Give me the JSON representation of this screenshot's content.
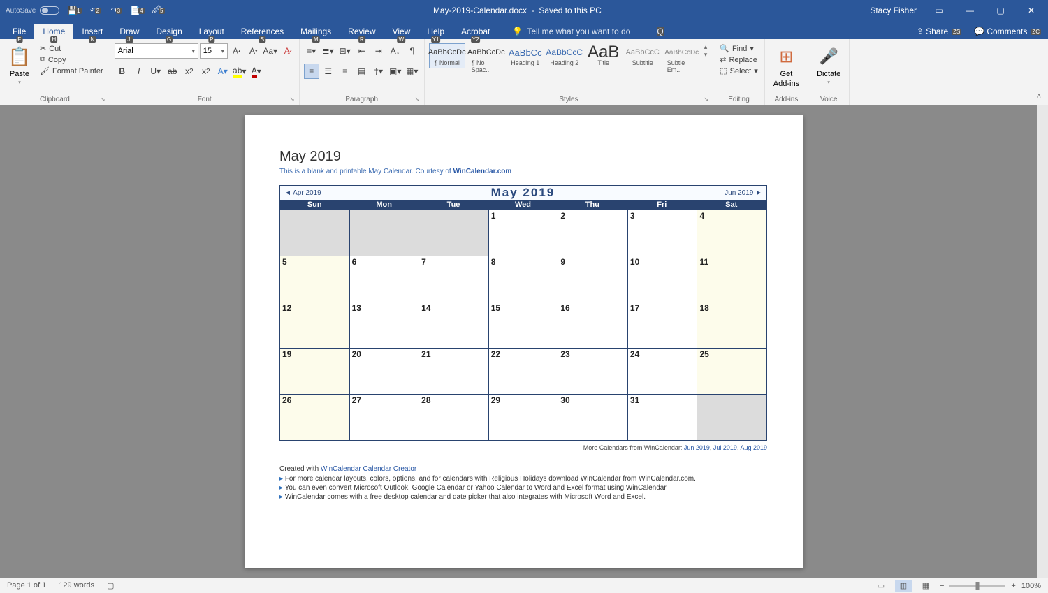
{
  "title_bar": {
    "autosave": "AutoSave",
    "filename": "May-2019-Calendar.docx",
    "savestate": "Saved to this PC",
    "user": "Stacy Fisher",
    "qat_badges": [
      "1",
      "2",
      "3",
      "4",
      "5"
    ]
  },
  "tabs": {
    "items": [
      {
        "label": "File",
        "k": "F"
      },
      {
        "label": "Home",
        "k": "H"
      },
      {
        "label": "Insert",
        "k": "N"
      },
      {
        "label": "Draw",
        "k": "JI"
      },
      {
        "label": "Design",
        "k": "G"
      },
      {
        "label": "Layout",
        "k": "P"
      },
      {
        "label": "References",
        "k": "S"
      },
      {
        "label": "Mailings",
        "k": "M"
      },
      {
        "label": "Review",
        "k": "R"
      },
      {
        "label": "View",
        "k": "W"
      },
      {
        "label": "Help",
        "k": "Y1"
      },
      {
        "label": "Acrobat",
        "k": "Y2"
      }
    ],
    "tellme_placeholder": "Tell me what you want to do",
    "tellme_k": "Q",
    "share": "Share",
    "share_k": "ZS",
    "comments": "Comments",
    "comments_k": "ZC"
  },
  "ribbon": {
    "clipboard": {
      "paste": "Paste",
      "cut": "Cut",
      "copy": "Copy",
      "format_painter": "Format Painter",
      "label": "Clipboard"
    },
    "font": {
      "name": "Arial",
      "size": "15",
      "label": "Font"
    },
    "paragraph": {
      "label": "Paragraph"
    },
    "styles": {
      "items": [
        {
          "p": "AaBbCcDc",
          "n": "¶ Normal"
        },
        {
          "p": "AaBbCcDc",
          "n": "¶ No Spac..."
        },
        {
          "p": "AaBbCc",
          "n": "Heading 1"
        },
        {
          "p": "AaBbCcC",
          "n": "Heading 2"
        },
        {
          "p": "AaB",
          "n": "Title"
        },
        {
          "p": "AaBbCcC",
          "n": "Subtitle"
        },
        {
          "p": "AaBbCcDc",
          "n": "Subtle Em..."
        }
      ],
      "label": "Styles"
    },
    "editing": {
      "find": "Find",
      "replace": "Replace",
      "select": "Select",
      "label": "Editing"
    },
    "addins": {
      "get": "Get",
      "addins": "Add-ins",
      "label": "Add-ins"
    },
    "voice": {
      "dictate": "Dictate",
      "label": "Voice"
    }
  },
  "document": {
    "title": "May 2019",
    "sub_prefix": "This is a blank and printable May Calendar.  Courtesy of ",
    "sub_link": "WinCalendar.com",
    "cal_title": "May  2019",
    "prev": "◄ Apr 2019",
    "next": "Jun 2019 ►",
    "dow": [
      "Sun",
      "Mon",
      "Tue",
      "Wed",
      "Thu",
      "Fri",
      "Sat"
    ],
    "grid": [
      [
        {
          "n": "",
          "c": "other"
        },
        {
          "n": "",
          "c": "other"
        },
        {
          "n": "",
          "c": "other"
        },
        {
          "n": "1"
        },
        {
          "n": "2"
        },
        {
          "n": "3"
        },
        {
          "n": "4",
          "c": "weekend"
        }
      ],
      [
        {
          "n": "5",
          "c": "weekend"
        },
        {
          "n": "6"
        },
        {
          "n": "7"
        },
        {
          "n": "8"
        },
        {
          "n": "9"
        },
        {
          "n": "10"
        },
        {
          "n": "11",
          "c": "weekend"
        }
      ],
      [
        {
          "n": "12",
          "c": "weekend"
        },
        {
          "n": "13"
        },
        {
          "n": "14"
        },
        {
          "n": "15"
        },
        {
          "n": "16"
        },
        {
          "n": "17"
        },
        {
          "n": "18",
          "c": "weekend"
        }
      ],
      [
        {
          "n": "19",
          "c": "weekend"
        },
        {
          "n": "20"
        },
        {
          "n": "21"
        },
        {
          "n": "22"
        },
        {
          "n": "23"
        },
        {
          "n": "24"
        },
        {
          "n": "25",
          "c": "weekend"
        }
      ],
      [
        {
          "n": "26",
          "c": "weekend"
        },
        {
          "n": "27"
        },
        {
          "n": "28"
        },
        {
          "n": "29"
        },
        {
          "n": "30"
        },
        {
          "n": "31"
        },
        {
          "n": "",
          "c": "other"
        }
      ]
    ],
    "more_prefix": "More Calendars from WinCalendar: ",
    "more_links": [
      "Jun 2019",
      "Jul 2019",
      "Aug 2019"
    ],
    "created_prefix": "Created with ",
    "created_link": "WinCalendar Calendar Creator",
    "bullets": [
      "For more calendar layouts, colors, options, and for calendars with Religious Holidays download WinCalendar from WinCalendar.com.",
      "You can even convert Microsoft Outlook, Google Calendar or Yahoo Calendar to Word and Excel format using WinCalendar.",
      "WinCalendar comes with a free desktop calendar and date picker that also integrates with Microsoft Word and Excel."
    ]
  },
  "status": {
    "page": "Page 1 of 1",
    "words": "129 words",
    "zoom": "100%"
  }
}
